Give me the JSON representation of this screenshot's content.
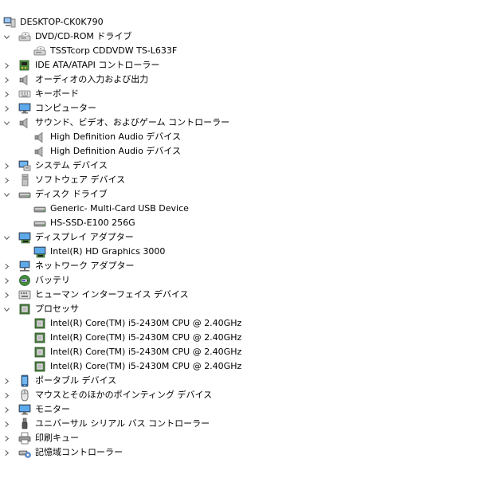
{
  "tree": {
    "root": {
      "label": "DESKTOP-CK0K790",
      "icon": "computer-root-icon"
    },
    "items": [
      {
        "label": "DVD/CD-ROM ドライブ",
        "icon": "dvd-drive-icon",
        "expanded": true,
        "children": [
          {
            "label": "TSSTcorp CDDVDW TS-L633F",
            "icon": "dvd-drive-icon"
          }
        ]
      },
      {
        "label": "IDE ATA/ATAPI コントローラー",
        "icon": "ide-controller-icon",
        "expanded": false
      },
      {
        "label": "オーディオの入力および出力",
        "icon": "speaker-icon",
        "expanded": false
      },
      {
        "label": "キーボード",
        "icon": "keyboard-icon",
        "expanded": false
      },
      {
        "label": "コンピューター",
        "icon": "computer-icon",
        "expanded": false
      },
      {
        "label": "サウンド、ビデオ、およびゲーム コントローラー",
        "icon": "speaker-icon",
        "expanded": true,
        "children": [
          {
            "label": "High Definition Audio デバイス",
            "icon": "speaker-icon"
          },
          {
            "label": "High Definition Audio デバイス",
            "icon": "speaker-icon"
          }
        ]
      },
      {
        "label": "システム デバイス",
        "icon": "system-device-icon",
        "expanded": false
      },
      {
        "label": "ソフトウェア デバイス",
        "icon": "software-device-icon",
        "expanded": false
      },
      {
        "label": "ディスク ドライブ",
        "icon": "disk-drive-icon",
        "expanded": true,
        "children": [
          {
            "label": "Generic- Multi-Card USB Device",
            "icon": "disk-drive-icon"
          },
          {
            "label": "HS-SSD-E100 256G",
            "icon": "disk-drive-icon"
          }
        ]
      },
      {
        "label": "ディスプレイ アダプター",
        "icon": "display-adapter-icon",
        "expanded": true,
        "children": [
          {
            "label": "Intel(R) HD Graphics 3000",
            "icon": "display-adapter-icon"
          }
        ]
      },
      {
        "label": "ネットワーク アダプター",
        "icon": "network-adapter-icon",
        "expanded": false
      },
      {
        "label": "バッテリ",
        "icon": "battery-icon",
        "expanded": false
      },
      {
        "label": "ヒューマン インターフェイス デバイス",
        "icon": "hid-icon",
        "expanded": false
      },
      {
        "label": "プロセッサ",
        "icon": "processor-icon",
        "expanded": true,
        "children": [
          {
            "label": "Intel(R) Core(TM) i5-2430M CPU @ 2.40GHz",
            "icon": "processor-icon"
          },
          {
            "label": "Intel(R) Core(TM) i5-2430M CPU @ 2.40GHz",
            "icon": "processor-icon"
          },
          {
            "label": "Intel(R) Core(TM) i5-2430M CPU @ 2.40GHz",
            "icon": "processor-icon"
          },
          {
            "label": "Intel(R) Core(TM) i5-2430M CPU @ 2.40GHz",
            "icon": "processor-icon"
          }
        ]
      },
      {
        "label": "ポータブル デバイス",
        "icon": "portable-device-icon",
        "expanded": false
      },
      {
        "label": "マウスとそのほかのポインティング デバイス",
        "icon": "mouse-icon",
        "expanded": false
      },
      {
        "label": "モニター",
        "icon": "monitor-icon",
        "expanded": false
      },
      {
        "label": "ユニバーサル シリアル バス コントローラー",
        "icon": "usb-icon",
        "expanded": false
      },
      {
        "label": "印刷キュー",
        "icon": "printer-icon",
        "expanded": false
      },
      {
        "label": "記憶域コントローラー",
        "icon": "storage-controller-icon",
        "expanded": false
      }
    ]
  }
}
